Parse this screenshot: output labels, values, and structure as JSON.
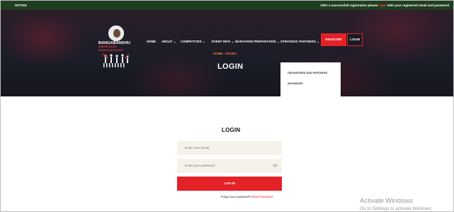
{
  "notice": {
    "label": "NOTICE",
    "text_before": "After a successfull registration please ",
    "link": "login",
    "text_after": " with your registered email and password"
  },
  "logo": {
    "title": "BANGABANDHU",
    "subtitle_line1": "SHEIKH MUJIB",
    "subtitle_line2": "DHAKA MARATHON"
  },
  "nav": {
    "items": [
      "HOME",
      "ABOUT ⌄",
      "COMPETITIES ⌄",
      "EVENT INFO ⌄",
      "MARATHON PREPARATION ⌄",
      "STRATEGIC PARTNERS ⌄"
    ],
    "register": "REGISTER",
    "login": "LOGIN"
  },
  "dropdown": {
    "items": [
      "ORGANIZERS AND PARTNERS",
      "SPONSORS"
    ]
  },
  "hero": {
    "breadcrumb": "HOME  -  PAGES",
    "title": "LOGIN"
  },
  "form": {
    "title": "LOGIN",
    "email_placeholder": "Enter Your Email",
    "password_placeholder": "Enter your password",
    "submit": "LOG IN",
    "forgot_text": "Forgot your password? ",
    "reset_link": "Reset Password"
  },
  "watermark": {
    "title": "Activate Windows",
    "subtitle": "Go to Settings to activate Windows."
  },
  "colors": {
    "accent": "#e32227",
    "notice_bg": "#1f3d1f",
    "breadcrumb": "#ff7a2b",
    "input_bg": "#f5f2ea"
  }
}
